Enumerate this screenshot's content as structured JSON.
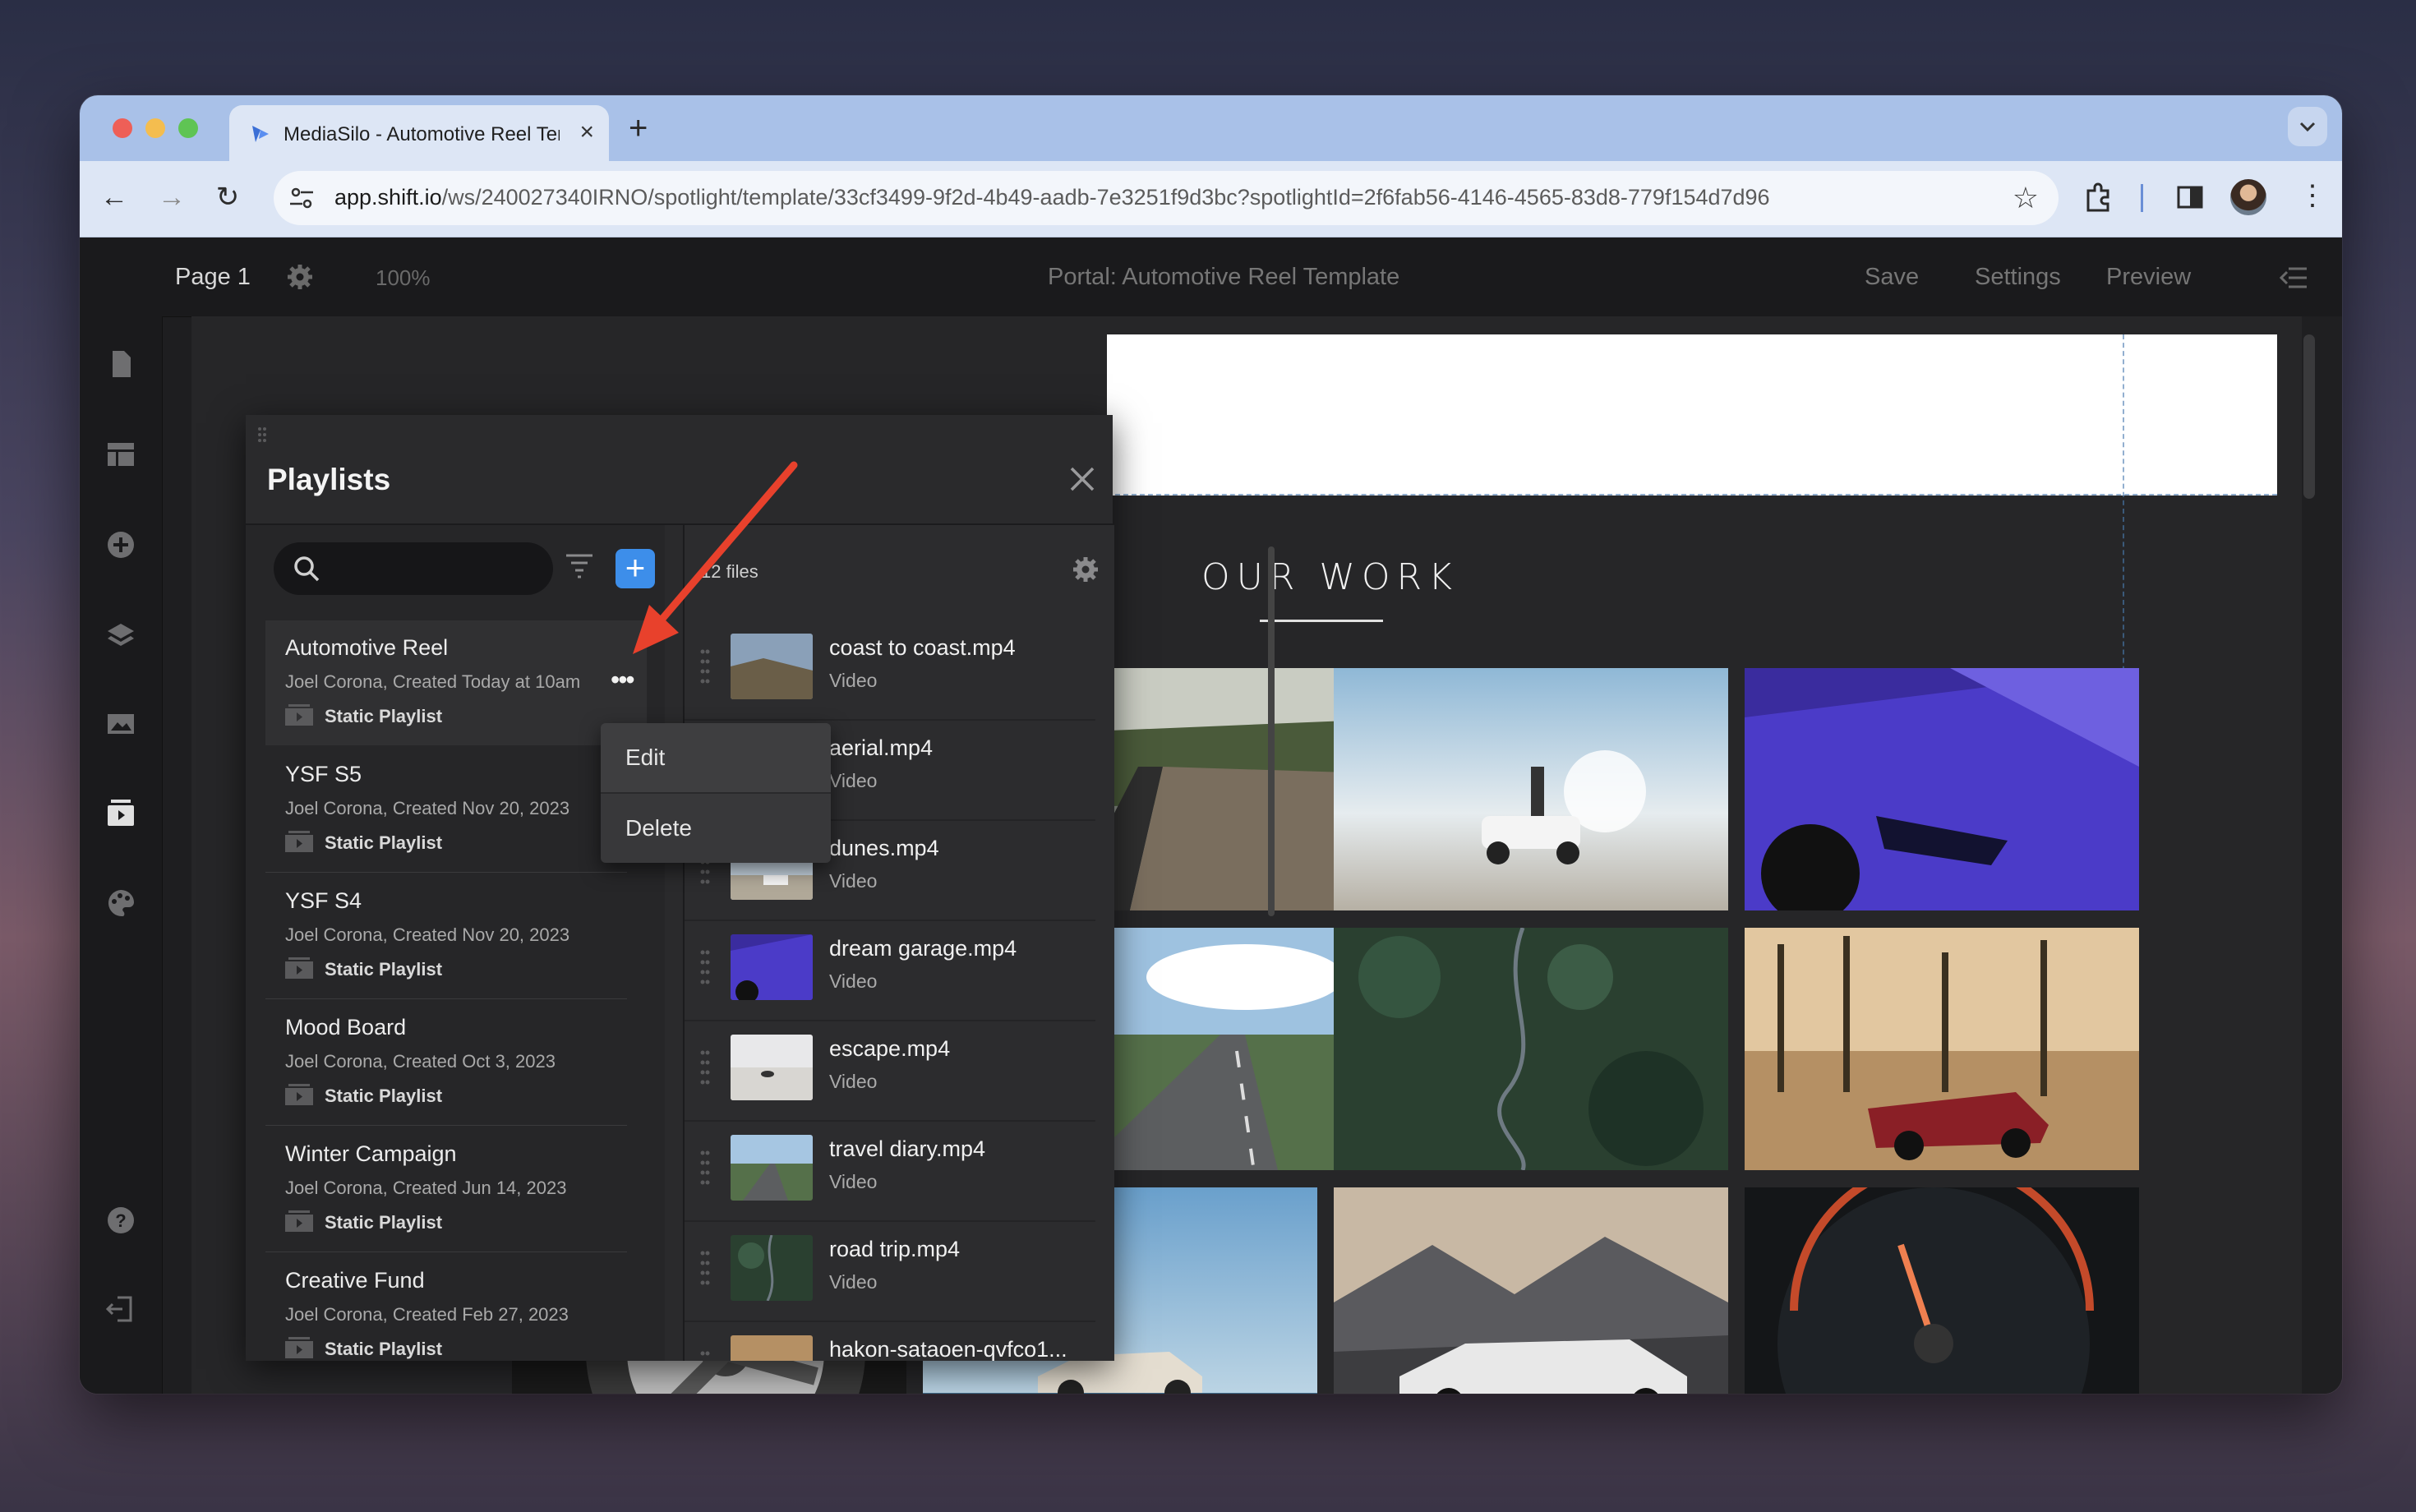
{
  "browser": {
    "tab_title": "MediaSilo - Automotive Reel Template",
    "tab_close": "×",
    "new_tab": "+",
    "url_host": "app.shift.io",
    "url_path": "/ws/240027340IRNO/spotlight/template/33cf3499-9f2d-4b49-aadb-7e3251f9d3bc?spotlightId=2f6fab56-4146-4565-83d8-779f154d7d96",
    "back": "←",
    "forward": "→",
    "reload": "↻",
    "star": "☆",
    "menu": "⋮"
  },
  "topbar": {
    "page_name": "Page 1",
    "zoom": "100%",
    "portal_title": "Portal: Automotive Reel Template",
    "save": "Save",
    "settings": "Settings",
    "preview": "Preview"
  },
  "canvas": {
    "section_title": "OUR WORK"
  },
  "panel": {
    "title": "Playlists",
    "add": "+",
    "files_count": "12 files",
    "playlists": [
      {
        "name": "Automotive Reel",
        "meta": "Joel Corona, Created Today at 10am",
        "type": "Static Playlist"
      },
      {
        "name": "YSF S5",
        "meta": "Joel Corona, Created Nov 20, 2023",
        "type": "Static Playlist"
      },
      {
        "name": "YSF S4",
        "meta": "Joel Corona, Created Nov 20, 2023",
        "type": "Static Playlist"
      },
      {
        "name": "Mood Board",
        "meta": "Joel Corona, Created Oct 3, 2023",
        "type": "Static Playlist"
      },
      {
        "name": "Winter Campaign",
        "meta": "Joel Corona, Created Jun 14, 2023",
        "type": "Static Playlist"
      },
      {
        "name": "Creative Fund",
        "meta": "Joel Corona, Created Feb 27, 2023",
        "type": "Static Playlist"
      }
    ],
    "files": [
      {
        "name": "coast to coast.mp4",
        "type": "Video"
      },
      {
        "name": "aerial.mp4",
        "type": "Video"
      },
      {
        "name": "dunes.mp4",
        "type": "Video"
      },
      {
        "name": "dream garage.mp4",
        "type": "Video"
      },
      {
        "name": "escape.mp4",
        "type": "Video"
      },
      {
        "name": "travel diary.mp4",
        "type": "Video"
      },
      {
        "name": "road trip.mp4",
        "type": "Video"
      },
      {
        "name": "hakon-sataoen-qvfco1...",
        "type": ""
      }
    ],
    "more_dots": "•••"
  },
  "context_menu": {
    "edit": "Edit",
    "delete": "Delete"
  },
  "colors": {
    "accent": "#3d8eea",
    "annotation_arrow": "#e8412c",
    "panel_bg": "#2a2a2c"
  }
}
